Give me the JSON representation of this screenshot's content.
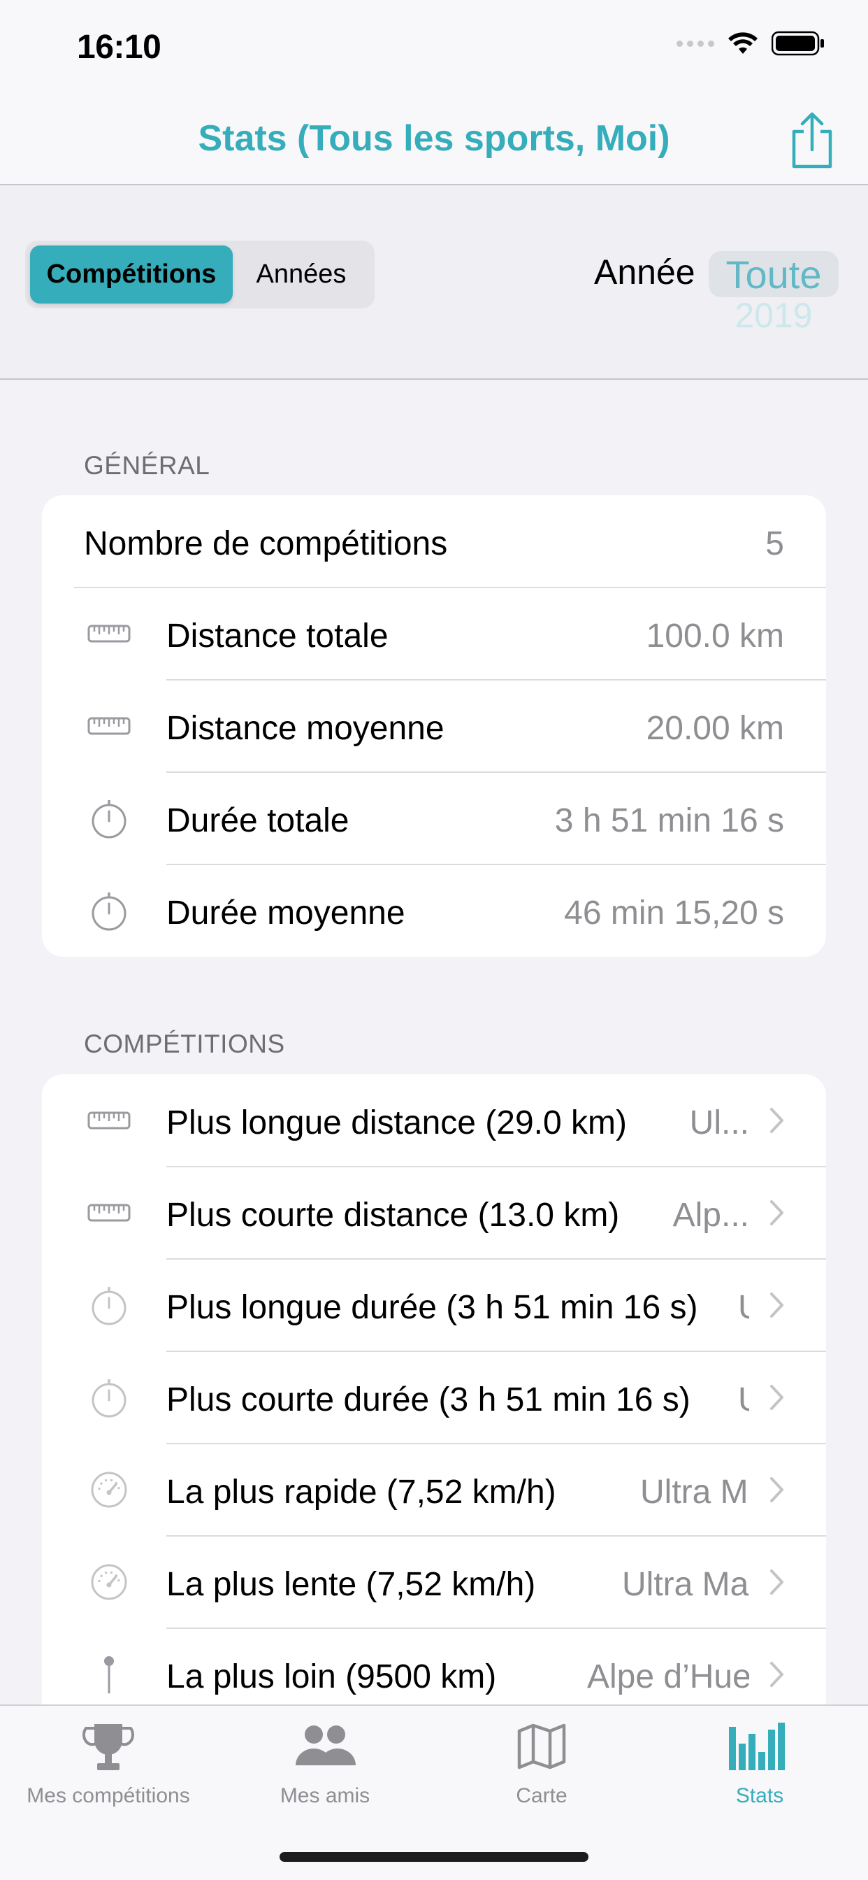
{
  "status_bar": {
    "time": "16:10"
  },
  "nav": {
    "title": "Stats (Tous les sports, Moi)",
    "share_icon": "share-icon"
  },
  "filter": {
    "segments": [
      "Compétitions",
      "Années"
    ],
    "selected_segment": "Compétitions",
    "year_label": "Année",
    "year_selected": "Toute",
    "year_next": "2019"
  },
  "general": {
    "header": "GÉNÉRAL",
    "rows": [
      {
        "label": "Nombre de compétitions",
        "value": "5"
      },
      {
        "icon": "ruler-icon",
        "label": "Distance totale",
        "value": "100.0 km"
      },
      {
        "icon": "ruler-icon",
        "label": "Distance moyenne",
        "value": "20.00 km"
      },
      {
        "icon": "stopwatch-icon",
        "label": "Durée totale",
        "value": "3 h 51 min 16 s"
      },
      {
        "icon": "stopwatch-icon",
        "label": "Durée moyenne",
        "value": "46 min 15,20 s"
      }
    ]
  },
  "competitions": {
    "header": "COMPÉTITIONS",
    "rows": [
      {
        "icon": "ruler-icon",
        "label": "Plus longue distance (29.0 km)",
        "detail": "Ul..."
      },
      {
        "icon": "ruler-icon",
        "label": "Plus courte distance (13.0 km)",
        "detail": "Alp..."
      },
      {
        "icon": "stopwatch-icon",
        "label": "Plus longue durée (3 h 51 min 16 s)",
        "detail": "U"
      },
      {
        "icon": "stopwatch-icon",
        "label": "Plus courte durée (3 h 51 min 16 s)",
        "detail": "U"
      },
      {
        "icon": "speedometer-icon",
        "label": "La plus rapide (7,52 km/h)",
        "detail": "Ultra M..."
      },
      {
        "icon": "speedometer-icon",
        "label": "La plus lente (7,52 km/h)",
        "detail": "Ultra Ma..."
      },
      {
        "icon": "pin-icon",
        "label": "La plus loin (9500 km)",
        "detail": "Alpe d’Huez"
      }
    ]
  },
  "tab_bar": {
    "tabs": [
      {
        "icon": "trophy-icon",
        "label": "Mes compétitions"
      },
      {
        "icon": "friends-icon",
        "label": "Mes amis"
      },
      {
        "icon": "map-icon",
        "label": "Carte"
      },
      {
        "icon": "bar-chart-icon",
        "label": "Stats"
      }
    ],
    "active": "Stats"
  },
  "colors": {
    "accent": "#35adba",
    "secondary_text": "#8e8e93",
    "background": "#f2f2f7"
  }
}
